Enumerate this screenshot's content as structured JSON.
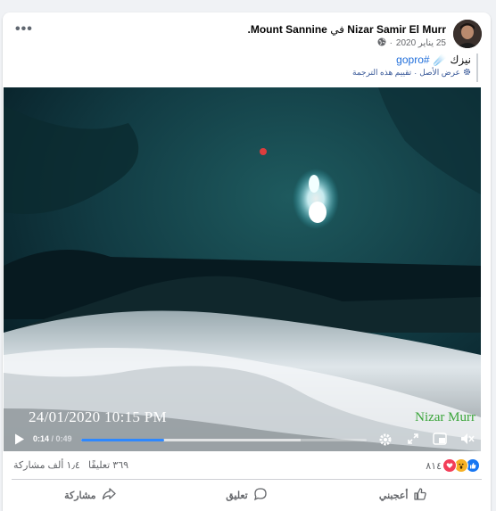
{
  "post": {
    "author": "Nizar Samir El Murr",
    "location_prefix": "في",
    "location": "Mount Sannine.",
    "date": "25 يناير 2020",
    "text": "نيزك",
    "emoji": "☄️",
    "hashtag": "#gopro",
    "see_original": "عرض الأصل",
    "separator": "·",
    "rate_translation": "تقييم هذه الترجمة",
    "more_label": "•••"
  },
  "video": {
    "timestamp_overlay": "24/01/2020  10:15 PM",
    "watermark": "Nizar Murr",
    "current_time": "0:14",
    "time_separator": " / ",
    "duration": "0:49",
    "progress_fraction": 0.29,
    "buffered_fraction": 0.77
  },
  "stats": {
    "reaction_count": "٨١٤",
    "comments": "٣٦٩ تعليقًا",
    "shares": "١٫٤ ألف مشاركة"
  },
  "actions": {
    "like": "أعجبني",
    "comment": "تعليق",
    "share": "مشاركة"
  },
  "colors": {
    "accent": "#2d88ff",
    "link": "#216fdb",
    "meta": "#65676b"
  }
}
